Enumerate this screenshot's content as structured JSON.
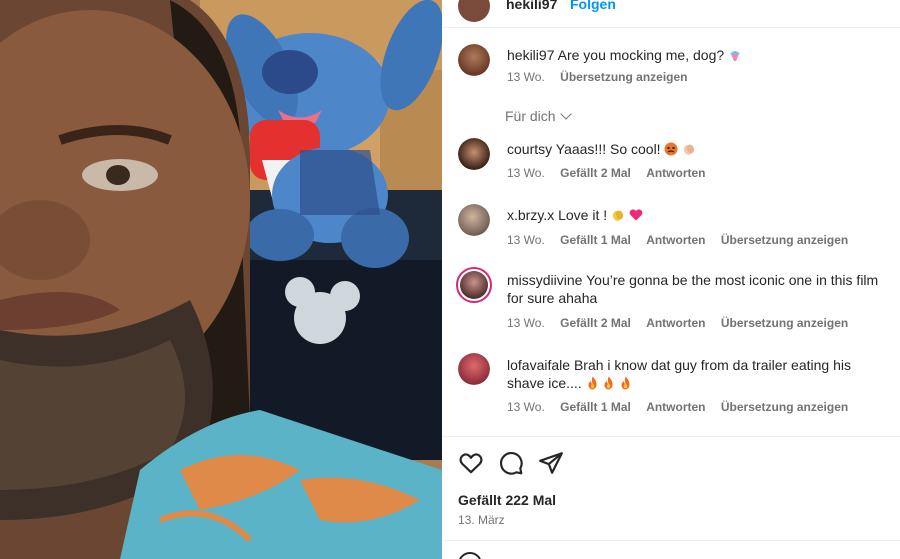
{
  "post": {
    "author": "hekili97",
    "follow_label": "Folgen"
  },
  "caption": {
    "user": "hekili97",
    "text": "Are you mocking me, dog?",
    "time": "13 Wo.",
    "translate": "Übersetzung anzeigen"
  },
  "for_you_label": "Für dich",
  "comments": [
    {
      "user": "courtsy",
      "text": "Yaaas!!! So cool!",
      "emojis": [
        "angry-face-emoji",
        "clapping-hands-emoji"
      ],
      "time": "13 Wo.",
      "likes": "Gefällt 2 Mal",
      "reply": "Antworten",
      "translate": ""
    },
    {
      "user": "x.brzy.x",
      "text": "Love it !",
      "emojis": [
        "clapping-hands-emoji",
        "heart-emoji"
      ],
      "time": "13 Wo.",
      "likes": "Gefällt 1 Mal",
      "reply": "Antworten",
      "translate": "Übersetzung anzeigen"
    },
    {
      "user": "missydiivine",
      "text": "You’re gonna be the most iconic one in this film for sure ahaha",
      "emojis": [],
      "time": "13 Wo.",
      "likes": "Gefällt 2 Mal",
      "reply": "Antworten",
      "translate": "Übersetzung anzeigen"
    },
    {
      "user": "lofavaifale",
      "text": "Brah i know dat guy from da trailer eating his shave ice....",
      "emojis": [
        "fire-emoji",
        "fire-emoji",
        "fire-emoji"
      ],
      "time": "13 Wo.",
      "likes": "Gefällt 1 Mal",
      "reply": "Antworten",
      "translate": "Übersetzung anzeigen"
    }
  ],
  "actions": {
    "like_icon": "heart-outline-icon",
    "comment_icon": "comment-bubble-icon",
    "share_icon": "paper-plane-icon"
  },
  "likes_total": "Gefällt 222 Mal",
  "post_date": "13. März",
  "colors": {
    "link": "#0095f6",
    "muted": "#737373",
    "text": "#262626",
    "story_ring": "#d62976"
  }
}
